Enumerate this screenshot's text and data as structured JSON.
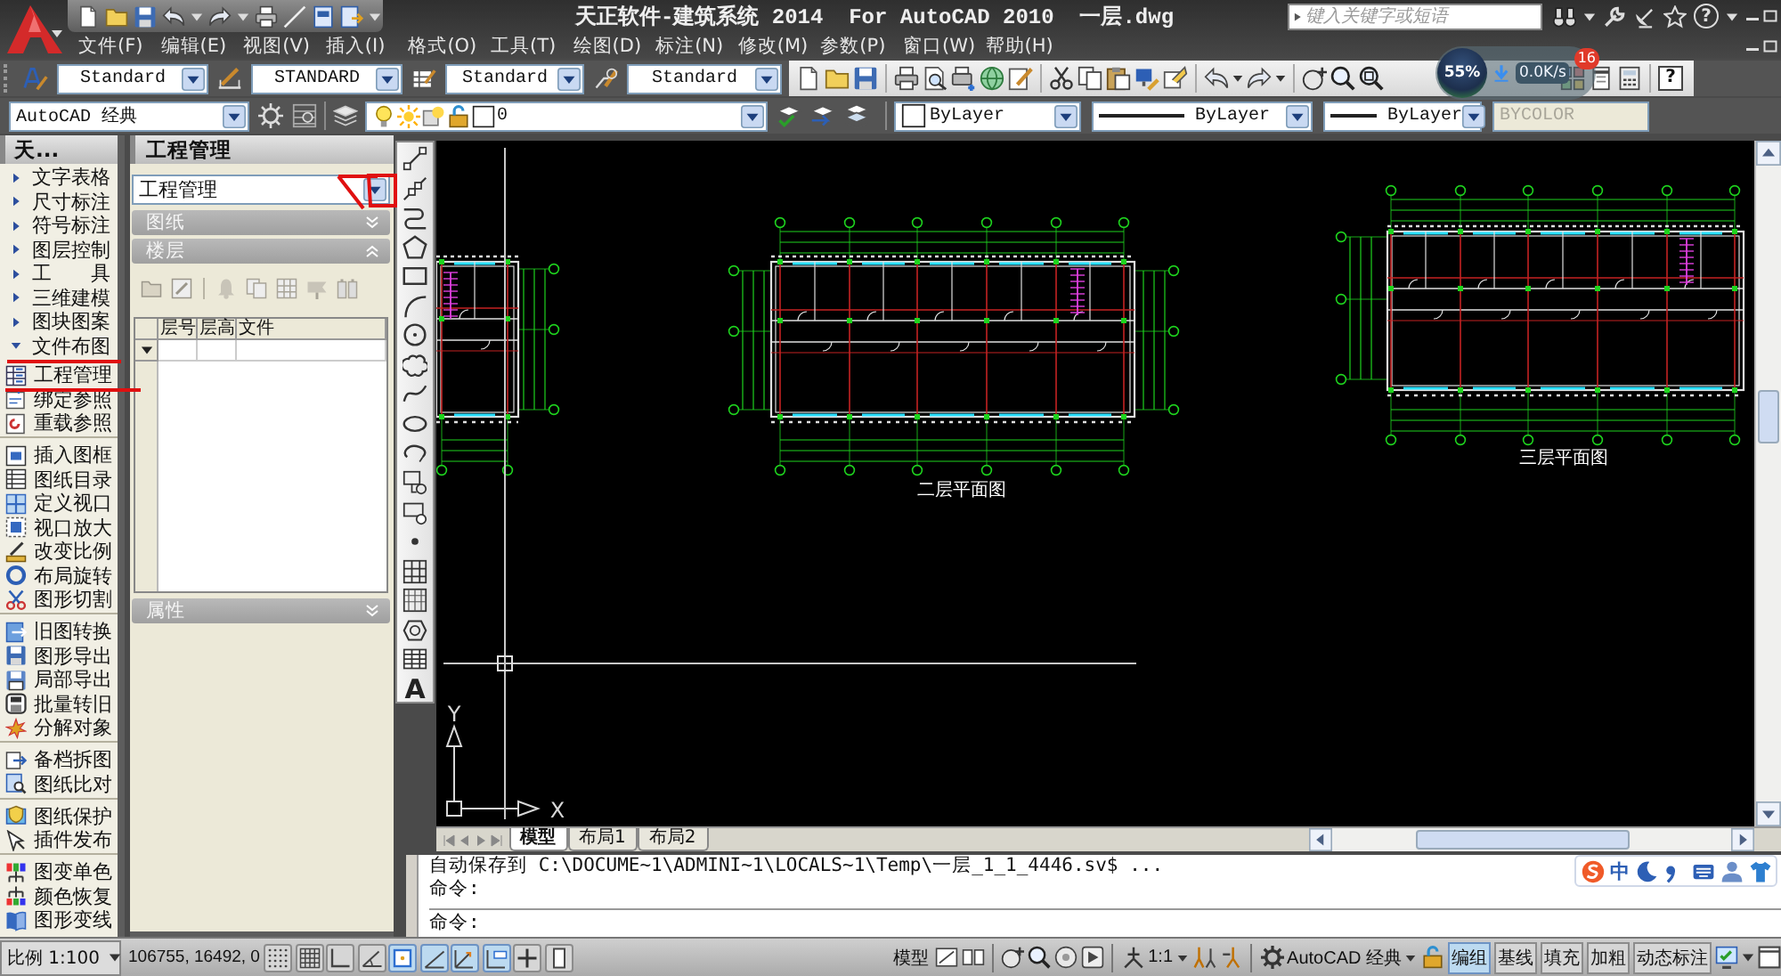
{
  "title_bar": {
    "title": "天正软件-建筑系统 2014  For AutoCAD 2010  一层.dwg",
    "search": {
      "placeholder": "键入关键字或短语"
    },
    "help": "?"
  },
  "menu": [
    "文件(F)",
    "编辑(E)",
    "视图(V)",
    "插入(I)",
    "格式(O)",
    "工具(T)",
    "绘图(D)",
    "标注(N)",
    "修改(M)",
    "参数(P)",
    "窗口(W)",
    "帮助(H)"
  ],
  "style_toolbar": {
    "styles": [
      "Standard",
      "STANDARD",
      "Standard",
      "Standard"
    ]
  },
  "standard_toolbar": {
    "help": "?"
  },
  "workspace_toolbar": {
    "workspace": "AutoCAD 经典"
  },
  "layer_toolbar": {
    "layer": "0"
  },
  "properties_toolbar": {
    "combos": [
      {
        "kind": "color",
        "value": "ByLayer",
        "disabled": false
      },
      {
        "kind": "linetype",
        "value": "ByLayer",
        "disabled": false
      },
      {
        "kind": "lineweight",
        "value": "ByLayer",
        "disabled": false
      },
      {
        "kind": "plotstyle",
        "value": "BYCOLOR",
        "disabled": true
      }
    ]
  },
  "speed_widget": {
    "load": "55%",
    "rate": "0.0K/s",
    "badge": "16"
  },
  "tool_palette": {
    "title": "天...",
    "categories": [
      {
        "label": "文字表格",
        "expanded": false
      },
      {
        "label": "尺寸标注",
        "expanded": false
      },
      {
        "label": "符号标注",
        "expanded": false
      },
      {
        "label": "图层控制",
        "expanded": false
      },
      {
        "label": "工　　具",
        "expanded": false
      },
      {
        "label": "三维建模",
        "expanded": false
      },
      {
        "label": "图块图案",
        "expanded": false
      },
      {
        "label": "文件布图",
        "expanded": true,
        "groups": [
          {
            "items": [
              "工程管理",
              "绑定参照",
              "重载参照"
            ]
          },
          {
            "items": [
              "插入图框",
              "图纸目录",
              "定义视口",
              "视口放大",
              "改变比例",
              "布局旋转",
              "图形切割"
            ]
          },
          {
            "items": [
              "旧图转换",
              "图形导出",
              "局部导出",
              "批量转旧",
              "分解对象"
            ]
          },
          {
            "items": [
              "备档拆图",
              "图纸比对"
            ]
          },
          {
            "items": [
              "图纸保护",
              "插件发布"
            ]
          },
          {
            "items": [
              "图变单色",
              "颜色恢复",
              "图形变线"
            ]
          }
        ]
      }
    ]
  },
  "project_panel": {
    "title": "工程管理",
    "selector": "工程管理",
    "sections": [
      {
        "label": "图纸",
        "expanded": false
      },
      {
        "label": "楼层",
        "expanded": true
      },
      {
        "label": "属性",
        "expanded": false
      }
    ],
    "table": {
      "columns": [
        "层号",
        "层高",
        "文件"
      ]
    }
  },
  "draw_toolbar": {
    "text_tool": "A"
  },
  "drawing": {
    "plans": [
      {
        "kind": "partial"
      },
      {
        "kind": "full",
        "title": "二层平面图"
      },
      {
        "kind": "full",
        "title": "三层平面图"
      }
    ],
    "ucs": {
      "x_label": "X",
      "y_label": "Y"
    }
  },
  "layout_tabs": [
    {
      "label": "模型",
      "selected": true
    },
    {
      "label": "布局1",
      "selected": false
    },
    {
      "label": "布局2",
      "selected": false
    }
  ],
  "command_window": {
    "history": [
      "自动保存到 C:\\DOCUME~1\\ADMINI~1\\LOCALS~1\\Temp\\一层_1_1_4446.sv$ ...",
      "命令:"
    ],
    "prompt": "命令:"
  },
  "ime_bar": {
    "mode": "中"
  },
  "status_bar": {
    "scale": "比例 1:100",
    "coordinates": "106755, 16492, 0",
    "toggles": [
      {
        "on": false
      },
      {
        "on": false
      },
      {
        "on": false
      },
      {
        "on": false
      },
      {
        "on": true
      },
      {
        "on": true
      },
      {
        "on": true
      },
      {
        "on": true
      },
      {
        "on": false
      },
      {
        "on": false
      }
    ],
    "space": "模型",
    "annotation_scale": "1:1",
    "workspace": "AutoCAD 经典",
    "tch_buttons": [
      {
        "label": "编组",
        "on": true
      },
      {
        "label": "基线",
        "on": false
      },
      {
        "label": "填充",
        "on": false
      },
      {
        "label": "加粗",
        "on": false
      },
      {
        "label": "动态标注",
        "on": false
      }
    ]
  }
}
